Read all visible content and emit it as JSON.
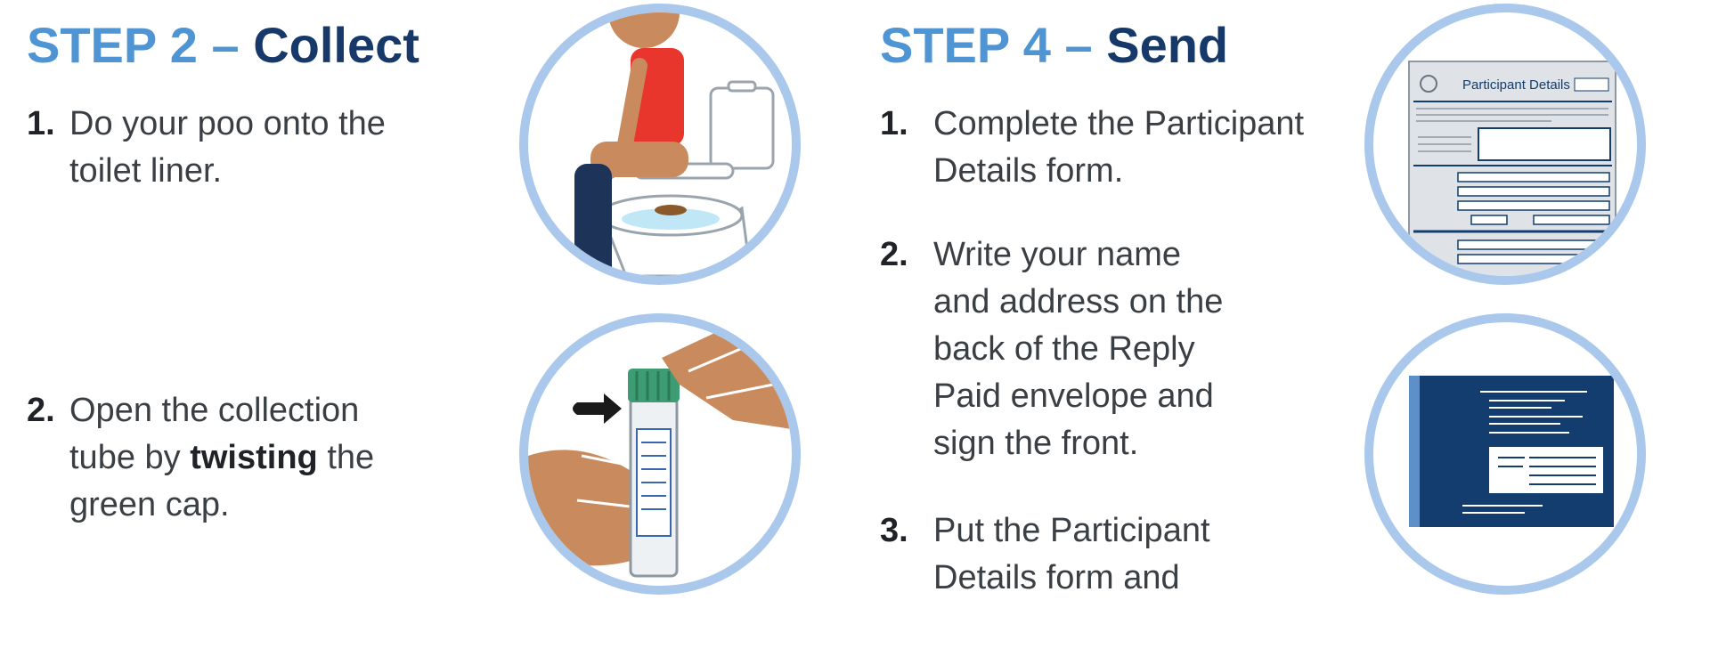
{
  "left": {
    "heading_light": "STEP 2 –",
    "heading_dark": "Collect",
    "steps": [
      {
        "num": "1.",
        "lines": [
          "Do your poo onto the",
          "toilet liner."
        ]
      },
      {
        "num": "2.",
        "lines": [
          "Open the collection",
          "twisting",
          "the",
          "green cap."
        ],
        "prefix": "tube by "
      }
    ]
  },
  "right": {
    "heading_light": "STEP 4 –",
    "heading_dark": "Send",
    "steps": [
      {
        "num": "1.",
        "lines": [
          "Complete the Participant",
          "Details form."
        ]
      },
      {
        "num": "2.",
        "lines": [
          "Write your name",
          "and address on the",
          "back of the Reply",
          "Paid envelope and",
          "sign the front."
        ]
      },
      {
        "num": "3.",
        "lines": [
          "Put the Participant",
          "Details form and"
        ]
      }
    ]
  },
  "form_thumbnail": {
    "title": "Participant Details"
  },
  "colors": {
    "heading_light": "#4f95d4",
    "heading_dark": "#17396a",
    "circle_border": "#a9c8ec",
    "envelope_blue": "#123d6e",
    "cap_green": "#3d9c73",
    "shirt_red": "#e8362c",
    "skin": "#c98b5e"
  },
  "icons": [
    "toilet-sitting-illustration",
    "collection-tube-illustration",
    "participant-form-illustration",
    "reply-envelope-illustration"
  ]
}
